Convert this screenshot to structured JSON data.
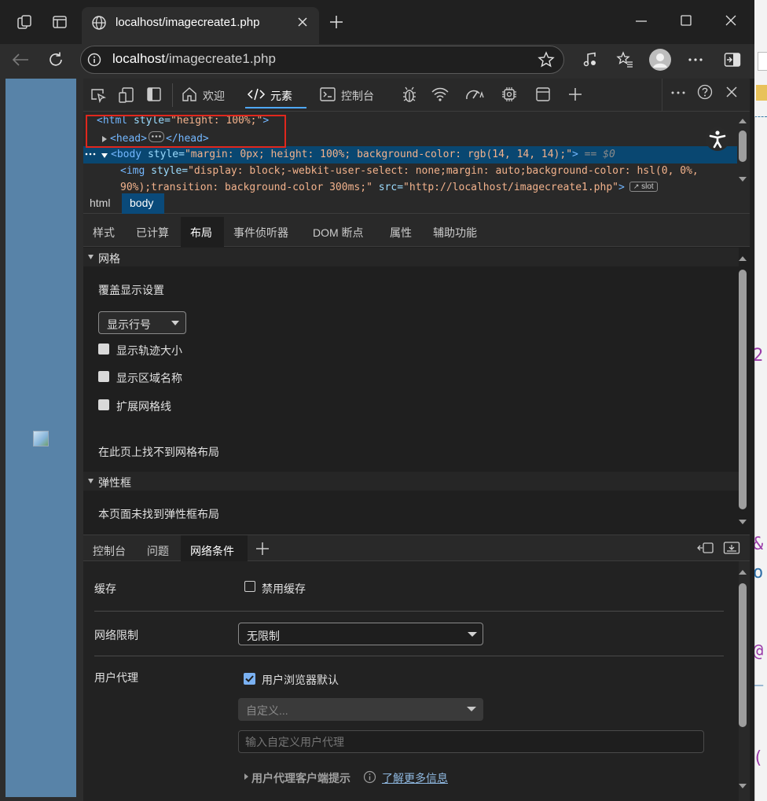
{
  "browser": {
    "tab_title": "localhost/imagecreate1.php",
    "url_host": "localhost",
    "url_path": "/imagecreate1.php"
  },
  "devtools": {
    "tabs": [
      {
        "label": "欢迎"
      },
      {
        "label": "元素"
      },
      {
        "label": "控制台"
      }
    ],
    "dom": {
      "html_open_tag": "<html",
      "html_attr": " style=",
      "html_val": "\"height: 100%;\"",
      "html_close": ">",
      "head_open": "<head>",
      "head_close": "</head>",
      "body_open": "<body",
      "body_attr": " style=",
      "body_val": "\"margin: 0px; height: 100%; background-color: rgb(14, 14, 14);\"",
      "body_close": ">",
      "body_eq": " == $0",
      "img_open": "<img",
      "img_attr1": " style=",
      "img_val1": "\"display: block;-webkit-user-select: none;margin: auto;background-color: hsl(0, 0%,",
      "img_line2a": "90%);transition: background-color 300ms;\"",
      "img_attr2": " src=",
      "img_val2": "\"http://localhost/imagecreate1.php\"",
      "img_close": ">",
      "slot": "slot"
    },
    "breadcrumbs": [
      "html",
      "body"
    ],
    "subtabs": [
      "样式",
      "已计算",
      "布局",
      "事件侦听器",
      "DOM 断点",
      "属性",
      "辅助功能"
    ],
    "layout": {
      "grid_section": "网格",
      "overlay_settings": "覆盖显示设置",
      "select_value": "显示行号",
      "checkboxes": [
        "显示轨迹大小",
        "显示区域名称",
        "扩展网格线"
      ],
      "grid_none": "在此页上找不到网格布局",
      "flex_section": "弹性框",
      "flex_none": "本页面未找到弹性框布局"
    },
    "drawer": {
      "tabs": [
        "控制台",
        "问题",
        "网络条件"
      ],
      "cache_label": "缓存",
      "disable_cache": "禁用缓存",
      "throttle_label": "网络限制",
      "throttle_value": "无限制",
      "ua_label": "用户代理",
      "ua_default": "用户浏览器默认",
      "ua_custom_placeholder": "自定义...",
      "ua_input_placeholder": "输入自定义用户代理",
      "ua_hints": "用户代理客户端提示",
      "learn_more": "了解更多信息"
    }
  }
}
